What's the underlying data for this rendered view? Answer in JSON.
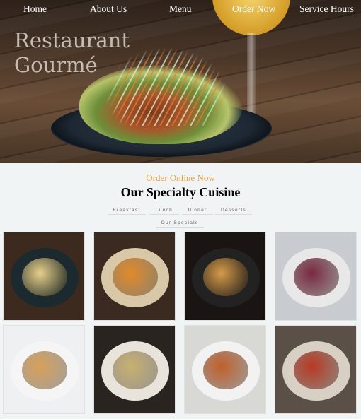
{
  "nav": {
    "items": [
      "Home",
      "About Us",
      "Menu",
      "Order Now",
      "Service Hours"
    ]
  },
  "hero": {
    "brand_line1": "Restaurant",
    "brand_line2": "Gourmé"
  },
  "specialty": {
    "kicker": "Order Online Now",
    "title": "Our Specialty Cuisine",
    "tabs": [
      "Breakfast",
      "Lunch",
      "Dinner",
      "Desserts",
      "Our Specials"
    ]
  },
  "gallery": {
    "tiles": [
      {
        "name": "breakfast-bowl",
        "bg": "#3b2a1d",
        "plate": "#1b2a2e",
        "food": "#e6d08a"
      },
      {
        "name": "roasted-squash-rice",
        "bg": "#3a2a20",
        "plate": "#d8c8a8",
        "food": "#e08a2a"
      },
      {
        "name": "blueberry-pancakes",
        "bg": "#1a1412",
        "plate": "#222",
        "food": "#d49a4a"
      },
      {
        "name": "gourmet-burger",
        "bg": "#c8ccd0",
        "plate": "#e8e8e8",
        "food": "#7a2a40"
      },
      {
        "name": "strawberry-waffles",
        "bg": "#eef0f2",
        "plate": "#f5f5f5",
        "food": "#d8a058"
      },
      {
        "name": "pasta-wine",
        "bg": "#2a2420",
        "plate": "#e8e4dc",
        "food": "#c8b070"
      },
      {
        "name": "grilled-skewers",
        "bg": "#d8d8d4",
        "plate": "#f2f2f2",
        "food": "#c0602a"
      },
      {
        "name": "tapas-spread",
        "bg": "#5a5048",
        "plate": "#d8d0c4",
        "food": "#b83a24"
      }
    ]
  }
}
